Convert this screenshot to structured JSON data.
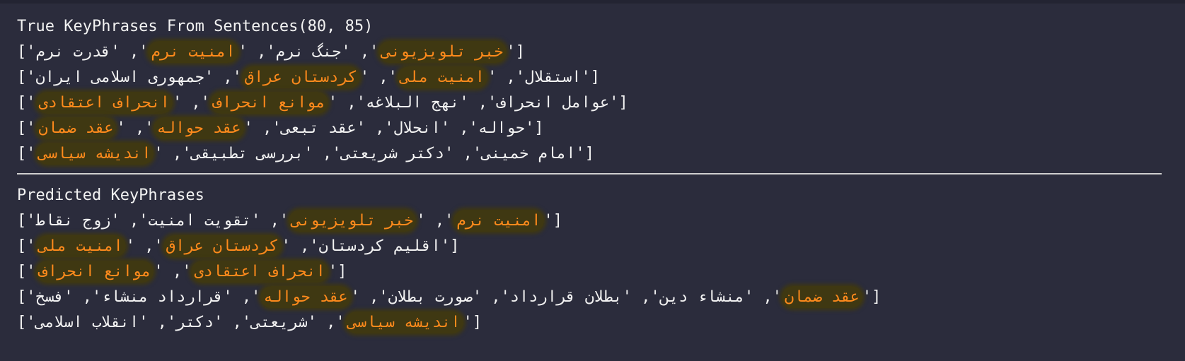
{
  "true_section": {
    "header": "True KeyPhrases From Sentences(80, 85)",
    "rows": [
      [
        {
          "t": "['",
          "h": false
        },
        {
          "t": "خبر تلویزیونی",
          "h": true
        },
        {
          "t": "', '",
          "h": false
        },
        {
          "t": "جنگ نرم",
          "h": false
        },
        {
          "t": "', '",
          "h": false
        },
        {
          "t": "امنیت نرم",
          "h": true
        },
        {
          "t": "', '",
          "h": false
        },
        {
          "t": "قدرت نرم",
          "h": false
        },
        {
          "t": "']",
          "h": false
        }
      ],
      [
        {
          "t": "['",
          "h": false
        },
        {
          "t": "استقلال",
          "h": false
        },
        {
          "t": "', '",
          "h": false
        },
        {
          "t": "امنیت ملی",
          "h": true
        },
        {
          "t": "', '",
          "h": false
        },
        {
          "t": "کردستان عراق",
          "h": true
        },
        {
          "t": "', '",
          "h": false
        },
        {
          "t": "جمهوری اسلامی ایران",
          "h": false
        },
        {
          "t": "']",
          "h": false
        }
      ],
      [
        {
          "t": "['",
          "h": false
        },
        {
          "t": "عوامل انحراف",
          "h": false
        },
        {
          "t": "', '",
          "h": false
        },
        {
          "t": "نهج البلاغه",
          "h": false
        },
        {
          "t": "', '",
          "h": false
        },
        {
          "t": "موانع انحراف",
          "h": true
        },
        {
          "t": "', '",
          "h": false
        },
        {
          "t": "انحراف اعتقادی",
          "h": true
        },
        {
          "t": "']",
          "h": false
        }
      ],
      [
        {
          "t": "['",
          "h": false
        },
        {
          "t": "حواله",
          "h": false
        },
        {
          "t": "', '",
          "h": false
        },
        {
          "t": "انحلال",
          "h": false
        },
        {
          "t": "', '",
          "h": false
        },
        {
          "t": "عقد تبعی",
          "h": false
        },
        {
          "t": "', '",
          "h": false
        },
        {
          "t": "عقد حواله",
          "h": true
        },
        {
          "t": "', '",
          "h": false
        },
        {
          "t": "عقد ضمان",
          "h": true
        },
        {
          "t": "']",
          "h": false
        }
      ],
      [
        {
          "t": "['",
          "h": false
        },
        {
          "t": "امام خمینی",
          "h": false
        },
        {
          "t": "', '",
          "h": false
        },
        {
          "t": "دکتر شریعتی",
          "h": false
        },
        {
          "t": "', '",
          "h": false
        },
        {
          "t": "بررسی تطبیقی",
          "h": false
        },
        {
          "t": "', '",
          "h": false
        },
        {
          "t": "اندیشه سیاسی",
          "h": true
        },
        {
          "t": "']",
          "h": false
        }
      ]
    ]
  },
  "predicted_section": {
    "header": "Predicted KeyPhrases",
    "rows": [
      [
        {
          "t": "['",
          "h": false
        },
        {
          "t": "امنیت نرم",
          "h": true
        },
        {
          "t": "', '",
          "h": false
        },
        {
          "t": "خبر تلویزیونی",
          "h": true
        },
        {
          "t": "', '",
          "h": false
        },
        {
          "t": "تقویت امنیت",
          "h": false
        },
        {
          "t": "', '",
          "h": false
        },
        {
          "t": "زوج نقاط",
          "h": false
        },
        {
          "t": "']",
          "h": false
        }
      ],
      [
        {
          "t": "['",
          "h": false
        },
        {
          "t": "اقلیم کردستان",
          "h": false
        },
        {
          "t": "', '",
          "h": false
        },
        {
          "t": "کردستان عراق",
          "h": true
        },
        {
          "t": "', '",
          "h": false
        },
        {
          "t": "امنیت ملی",
          "h": true
        },
        {
          "t": "']",
          "h": false
        }
      ],
      [
        {
          "t": "['",
          "h": false
        },
        {
          "t": "انحراف اعتقادی",
          "h": true
        },
        {
          "t": "', '",
          "h": false
        },
        {
          "t": "موانع انحراف",
          "h": true
        },
        {
          "t": "']",
          "h": false
        }
      ],
      [
        {
          "t": "['",
          "h": false
        },
        {
          "t": "عقد ضمان",
          "h": true
        },
        {
          "t": "', '",
          "h": false
        },
        {
          "t": "منشاء دین",
          "h": false
        },
        {
          "t": "', '",
          "h": false
        },
        {
          "t": "بطلان قرارداد",
          "h": false
        },
        {
          "t": "', '",
          "h": false
        },
        {
          "t": "صورت بطلان",
          "h": false
        },
        {
          "t": "', '",
          "h": false
        },
        {
          "t": "عقد حواله",
          "h": true
        },
        {
          "t": "', '",
          "h": false
        },
        {
          "t": "قرارداد منشاء",
          "h": false
        },
        {
          "t": "', '",
          "h": false
        },
        {
          "t": "فسخ",
          "h": false
        },
        {
          "t": "']",
          "h": false
        }
      ],
      [
        {
          "t": "['",
          "h": false
        },
        {
          "t": "اندیشه سیاسی",
          "h": true
        },
        {
          "t": "', '",
          "h": false
        },
        {
          "t": "شریعتی",
          "h": false
        },
        {
          "t": "', '",
          "h": false
        },
        {
          "t": "دکتر",
          "h": false
        },
        {
          "t": "', '",
          "h": false
        },
        {
          "t": "انقلاب اسلامی",
          "h": false
        },
        {
          "t": "']",
          "h": false
        }
      ]
    ]
  },
  "colors": {
    "background": "#2b2c3c",
    "text": "#f2f2f2",
    "highlight_text": "#ff8a1c",
    "highlight_bg": "#3f3812"
  }
}
